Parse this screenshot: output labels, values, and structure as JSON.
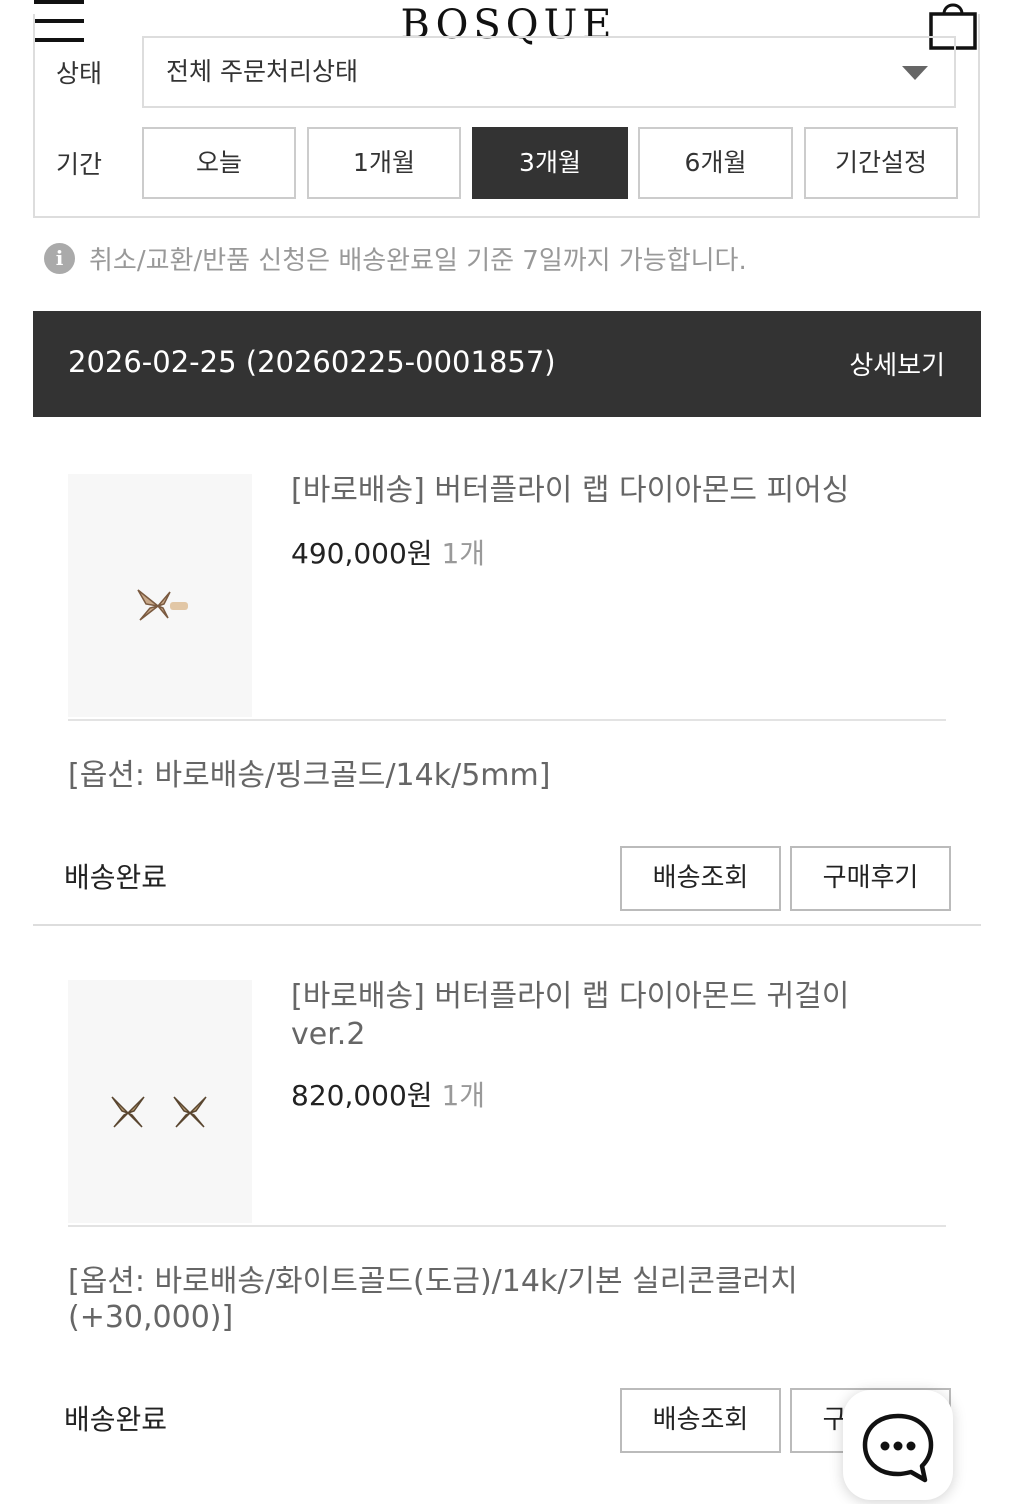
{
  "header": {
    "brand": "BOSQUE"
  },
  "filter": {
    "status_label": "상태",
    "status_value": "전체 주문처리상태",
    "period_label": "기간",
    "periods": [
      "오늘",
      "1개월",
      "3개월",
      "6개월",
      "기간설정"
    ],
    "active_period": "3개월"
  },
  "notice": "취소/교환/반품 신청은 배송완료일 기준 7일까지 가능합니다.",
  "order": {
    "date": "2026-02-25",
    "number": "(20260225-0001857)",
    "detail_label": "상세보기"
  },
  "items": [
    {
      "name": "[바로배송] 버터플라이 랩 다이아몬드 피어싱",
      "price": "490,000원",
      "qty": "1개",
      "option": "[옵션: 바로배송/핑크골드/14k/5mm]",
      "status": "배송완료",
      "track_label": "배송조회",
      "review_label": "구매후기"
    },
    {
      "name": "[바로배송] 버터플라이 랩 다이아몬드 귀걸이 ver.2",
      "price": "820,000원",
      "qty": "1개",
      "option": "[옵션: 바로배송/화이트골드(도금)/14k/기본 실리콘클러치 (+30,000)]",
      "status": "배송완료",
      "track_label": "배송조회",
      "review_label": "구매후기"
    }
  ],
  "colors": {
    "dark": "#333333",
    "border": "#dddddd",
    "muted": "#999999"
  }
}
